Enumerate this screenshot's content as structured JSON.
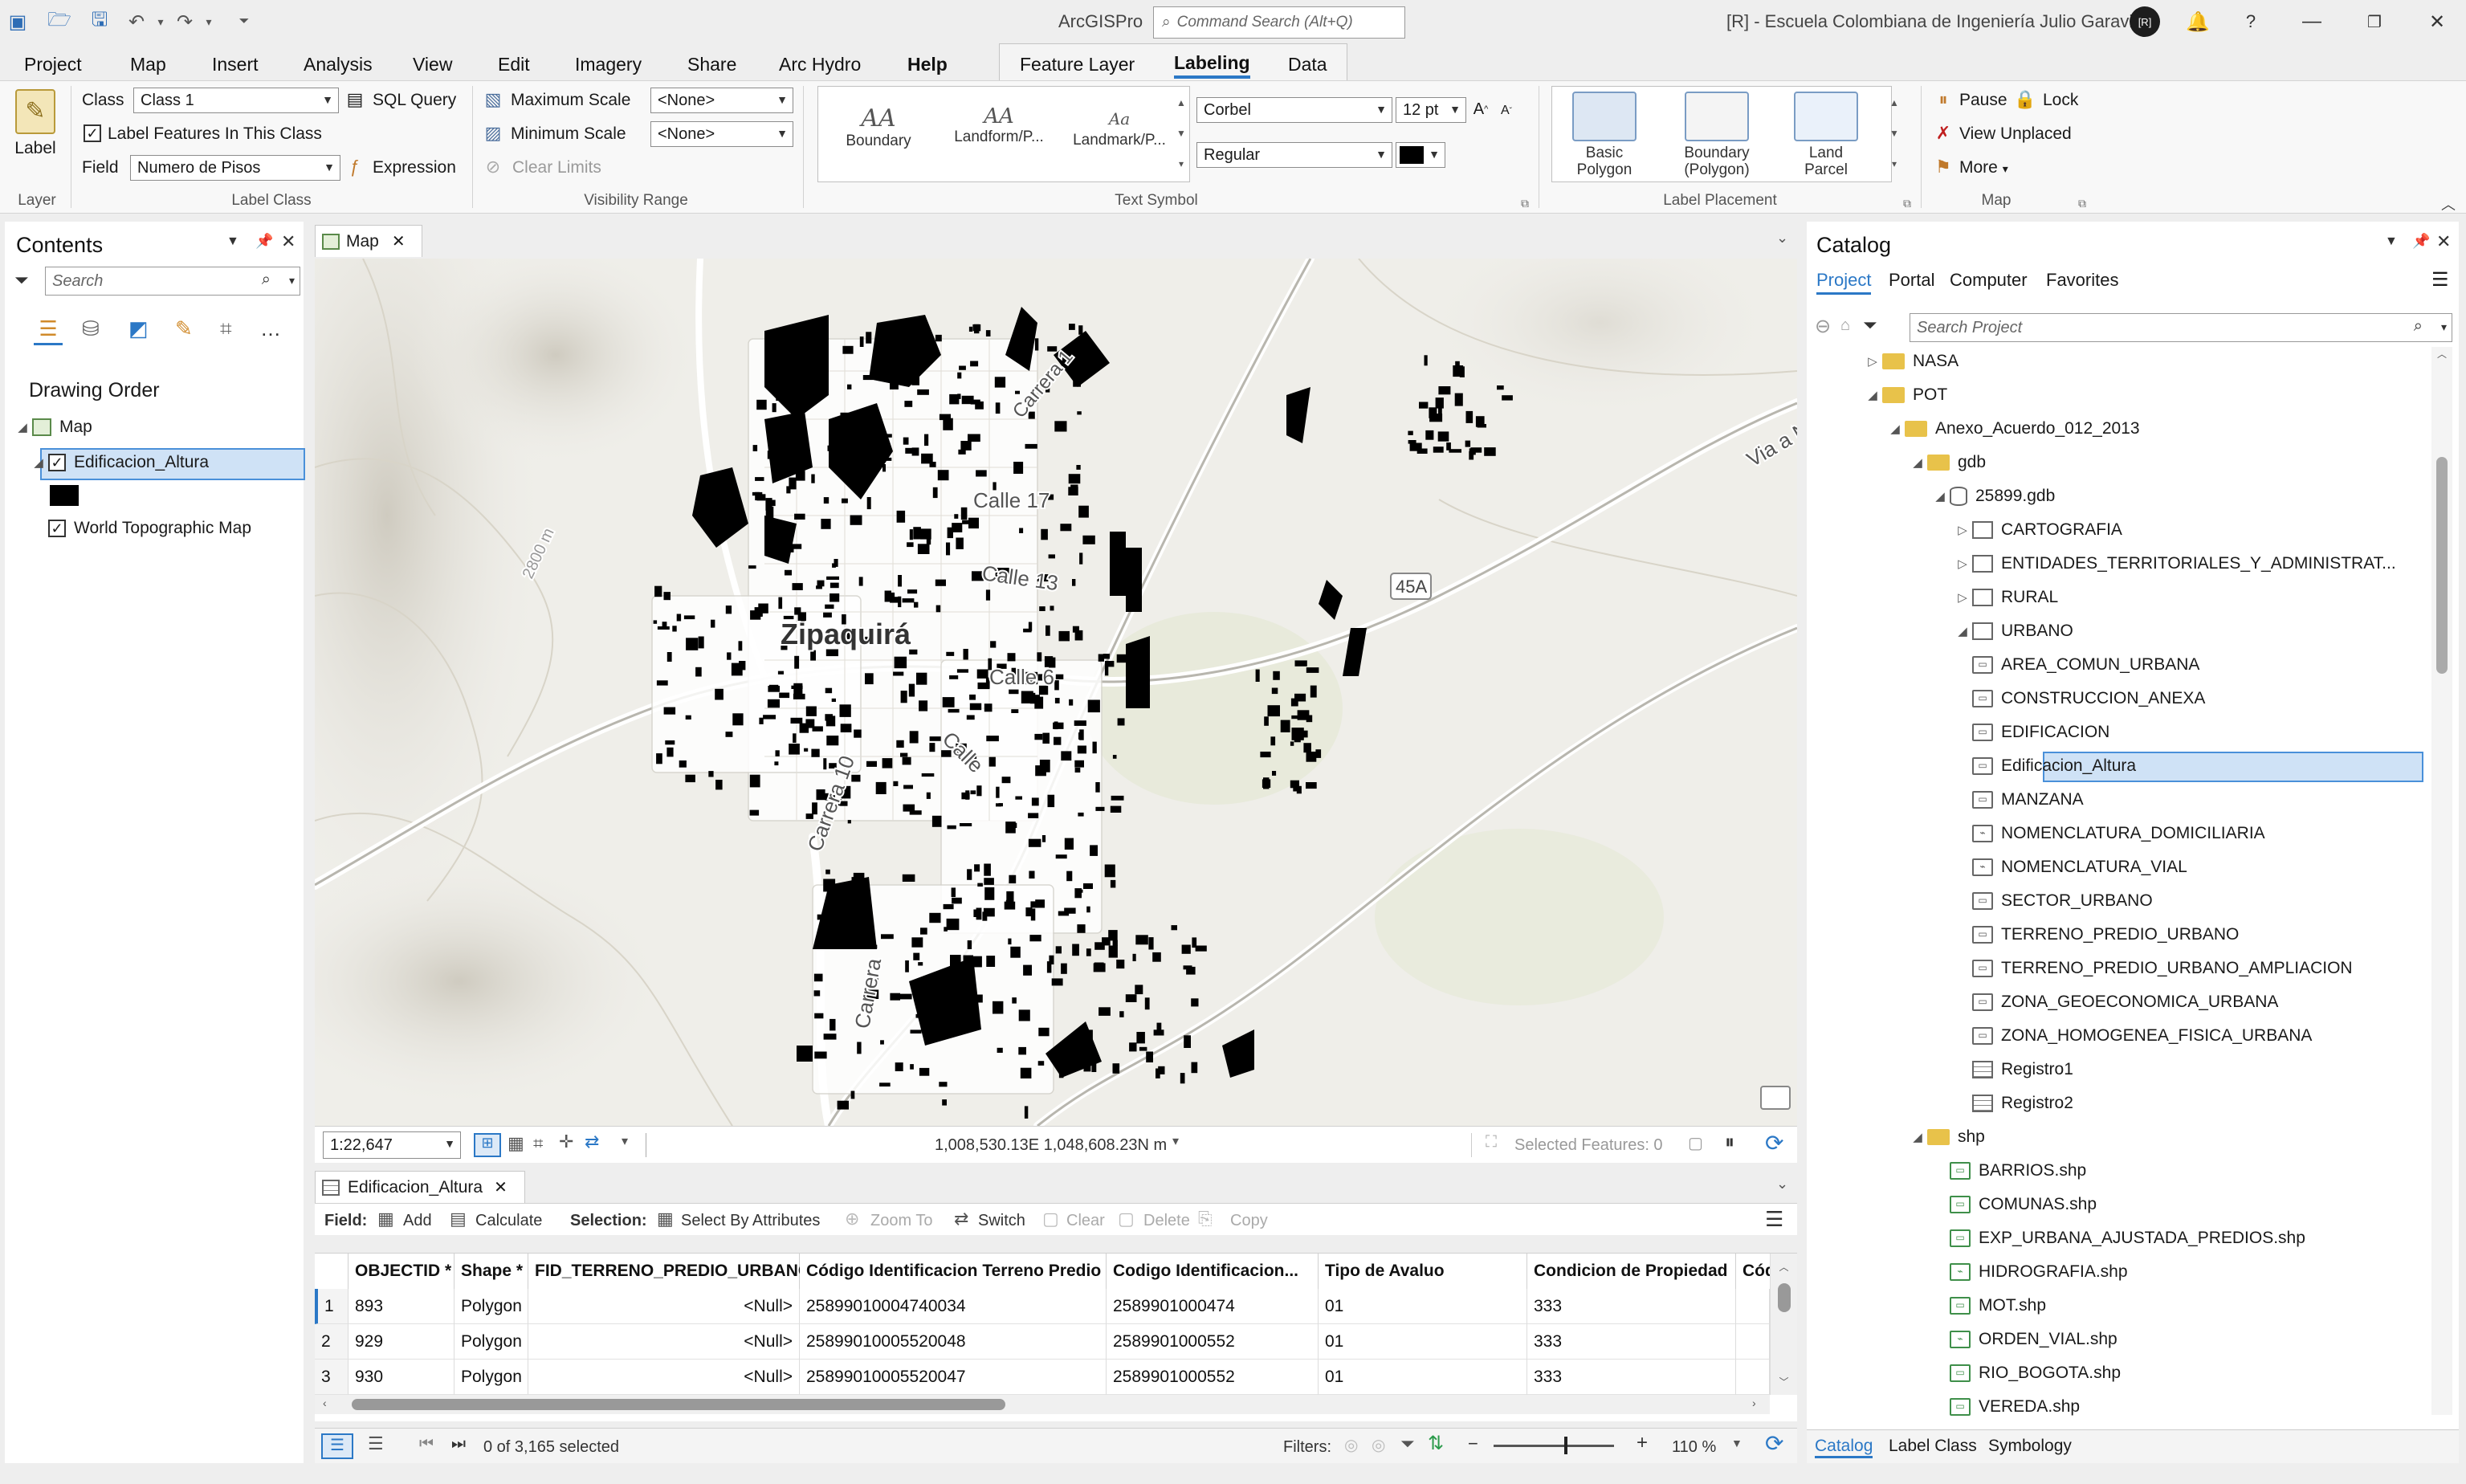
{
  "app": {
    "title": "ArcGISPro",
    "command_search_placeholder": "Command Search (Alt+Q)",
    "portal_user": "[R] - Escuela Colombiana de Ingeniería Julio Garavito",
    "avatar_initials": "[R]",
    "help_label": "?"
  },
  "menu": {
    "tabs": [
      "Project",
      "Map",
      "Insert",
      "Analysis",
      "View",
      "Edit",
      "Imagery",
      "Share",
      "Arc Hydro",
      "Help"
    ],
    "context_tabs": [
      "Feature Layer",
      "Labeling",
      "Data"
    ],
    "active_tab": "Labeling"
  },
  "ribbon": {
    "layer_group": {
      "button": "Label",
      "label": "Layer"
    },
    "label_class": {
      "class_label": "Class",
      "class_value": "Class 1",
      "sql_query": "SQL Query",
      "label_features": "Label Features In This Class",
      "field_label": "Field",
      "field_value": "Numero de Pisos",
      "expression": "Expression",
      "group_label": "Label Class"
    },
    "visibility": {
      "max_scale": "Maximum Scale",
      "min_scale": "Minimum Scale",
      "max_value": "<None>",
      "min_value": "<None>",
      "clear_limits": "Clear Limits",
      "group_label": "Visibility Range"
    },
    "text_symbol": {
      "styles": [
        "Boundary",
        "Landform/P...",
        "Landmark/P..."
      ],
      "font": "Corbel",
      "size": "12 pt",
      "style": "Regular",
      "color": "#000000",
      "group_label": "Text Symbol"
    },
    "label_placement": {
      "items": [
        "Basic\nPolygon",
        "Boundary\n(Polygon)",
        "Land\nParcel"
      ],
      "group_label": "Label Placement"
    },
    "map_group": {
      "pause": "Pause",
      "lock": "Lock",
      "view_unplaced": "View Unplaced",
      "more": "More",
      "group_label": "Map"
    }
  },
  "contents": {
    "title": "Contents",
    "search_placeholder": "Search",
    "section": "Drawing Order",
    "items": [
      {
        "label": "Map",
        "checked": null
      },
      {
        "label": "Edificacion_Altura",
        "checked": true
      },
      {
        "label": "World Topographic Map",
        "checked": true
      }
    ]
  },
  "map": {
    "tab": "Map",
    "scale": "1:22,647",
    "coords": "1,008,530.13E 1,048,608.23N m",
    "selected_features": "Selected Features: 0",
    "labels": {
      "town": "Zipaquirá",
      "calle17": "Calle 17",
      "calle13": "Calle 13",
      "calle6": "Calle 6",
      "carrera10": "Carrera 10",
      "carrera_lower": "Carrera",
      "calle_diag": "Calle",
      "calle_ne": "Carrera 1",
      "via": "Via a N",
      "route": "45A",
      "contour": "2800 m"
    }
  },
  "attribute_table": {
    "tab": "Edificacion_Altura",
    "toolbar": {
      "field": "Field:",
      "add": "Add",
      "calculate": "Calculate",
      "selection": "Selection:",
      "select_by_attributes": "Select By Attributes",
      "zoom_to": "Zoom To",
      "switch": "Switch",
      "clear": "Clear",
      "delete": "Delete",
      "copy": "Copy"
    },
    "columns": [
      "OBJECTID *",
      "Shape *",
      "FID_TERRENO_PREDIO_URBANO",
      "Código Identificacion Terreno Predio",
      "Codigo Identificacion...",
      "Tipo de Avaluo",
      "Condicion de Propiedad",
      "Cód"
    ],
    "rows": [
      [
        "1",
        "893",
        "Polygon",
        "<Null>",
        "25899010004740034",
        "2589901000474",
        "01",
        "333"
      ],
      [
        "2",
        "929",
        "Polygon",
        "<Null>",
        "25899010005520048",
        "2589901000552",
        "01",
        "333"
      ],
      [
        "3",
        "930",
        "Polygon",
        "<Null>",
        "25899010005520047",
        "2589901000552",
        "01",
        "333"
      ]
    ],
    "status": "0 of 3,165 selected",
    "filters": "Filters:",
    "zoom": "110 %"
  },
  "catalog": {
    "title": "Catalog",
    "tabs": [
      "Project",
      "Portal",
      "Computer",
      "Favorites"
    ],
    "search_placeholder": "Search Project",
    "tree": [
      {
        "label": "NASA",
        "type": "folder",
        "level": 0,
        "tri": "▷"
      },
      {
        "label": "POT",
        "type": "folder",
        "level": 0,
        "tri": "◢"
      },
      {
        "label": "Anexo_Acuerdo_012_2013",
        "type": "folder",
        "level": 1,
        "tri": "◢"
      },
      {
        "label": "gdb",
        "type": "folder",
        "level": 2,
        "tri": "◢"
      },
      {
        "label": "25899.gdb",
        "type": "db",
        "level": 3,
        "tri": "◢"
      },
      {
        "label": "CARTOGRAFIA",
        "type": "ds",
        "level": 4,
        "tri": "▷"
      },
      {
        "label": "ENTIDADES_TERRITORIALES_Y_ADMINISTRAT...",
        "type": "ds",
        "level": 4,
        "tri": "▷"
      },
      {
        "label": "RURAL",
        "type": "ds",
        "level": 4,
        "tri": "▷"
      },
      {
        "label": "URBANO",
        "type": "ds",
        "level": 4,
        "tri": "◢"
      },
      {
        "label": "AREA_COMUN_URBANA",
        "type": "fc",
        "level": 5,
        "tri": ""
      },
      {
        "label": "CONSTRUCCION_ANEXA",
        "type": "fc",
        "level": 5,
        "tri": ""
      },
      {
        "label": "EDIFICACION",
        "type": "fc",
        "level": 5,
        "tri": ""
      },
      {
        "label": "Edificacion_Altura",
        "type": "fc",
        "level": 5,
        "tri": "",
        "selected": true
      },
      {
        "label": "MANZANA",
        "type": "fc",
        "level": 5,
        "tri": ""
      },
      {
        "label": "NOMENCLATURA_DOMICILIARIA",
        "type": "fcl",
        "level": 5,
        "tri": ""
      },
      {
        "label": "NOMENCLATURA_VIAL",
        "type": "fcl",
        "level": 5,
        "tri": ""
      },
      {
        "label": "SECTOR_URBANO",
        "type": "fc",
        "level": 5,
        "tri": ""
      },
      {
        "label": "TERRENO_PREDIO_URBANO",
        "type": "fc",
        "level": 5,
        "tri": ""
      },
      {
        "label": "TERRENO_PREDIO_URBANO_AMPLIACION",
        "type": "fc",
        "level": 5,
        "tri": ""
      },
      {
        "label": "ZONA_GEOECONOMICA_URBANA",
        "type": "fc",
        "level": 5,
        "tri": ""
      },
      {
        "label": "ZONA_HOMOGENEA_FISICA_URBANA",
        "type": "fc",
        "level": 5,
        "tri": ""
      },
      {
        "label": "Registro1",
        "type": "tbl",
        "level": 4,
        "tri": ""
      },
      {
        "label": "Registro2",
        "type": "tbl",
        "level": 4,
        "tri": ""
      },
      {
        "label": "shp",
        "type": "folder",
        "level": 2,
        "tri": "◢"
      },
      {
        "label": "BARRIOS.shp",
        "type": "fcg",
        "level": 3,
        "tri": ""
      },
      {
        "label": "COMUNAS.shp",
        "type": "fcg",
        "level": 3,
        "tri": ""
      },
      {
        "label": "EXP_URBANA_AJUSTADA_PREDIOS.shp",
        "type": "fcg",
        "level": 3,
        "tri": ""
      },
      {
        "label": "HIDROGRAFIA.shp",
        "type": "fclg",
        "level": 3,
        "tri": ""
      },
      {
        "label": "MOT.shp",
        "type": "fcg",
        "level": 3,
        "tri": ""
      },
      {
        "label": "ORDEN_VIAL.shp",
        "type": "fclg",
        "level": 3,
        "tri": ""
      },
      {
        "label": "RIO_BOGOTA.shp",
        "type": "fcg",
        "level": 3,
        "tri": ""
      },
      {
        "label": "VEREDA.shp",
        "type": "fcg",
        "level": 3,
        "tri": ""
      }
    ],
    "bottom_tabs": [
      "Catalog",
      "Label Class",
      "Symbology"
    ]
  },
  "colors": {
    "accent": "#2b78c6",
    "selection": "#cfe2f6",
    "selection_border": "#4a90d9",
    "folder": "#e8c24a"
  }
}
